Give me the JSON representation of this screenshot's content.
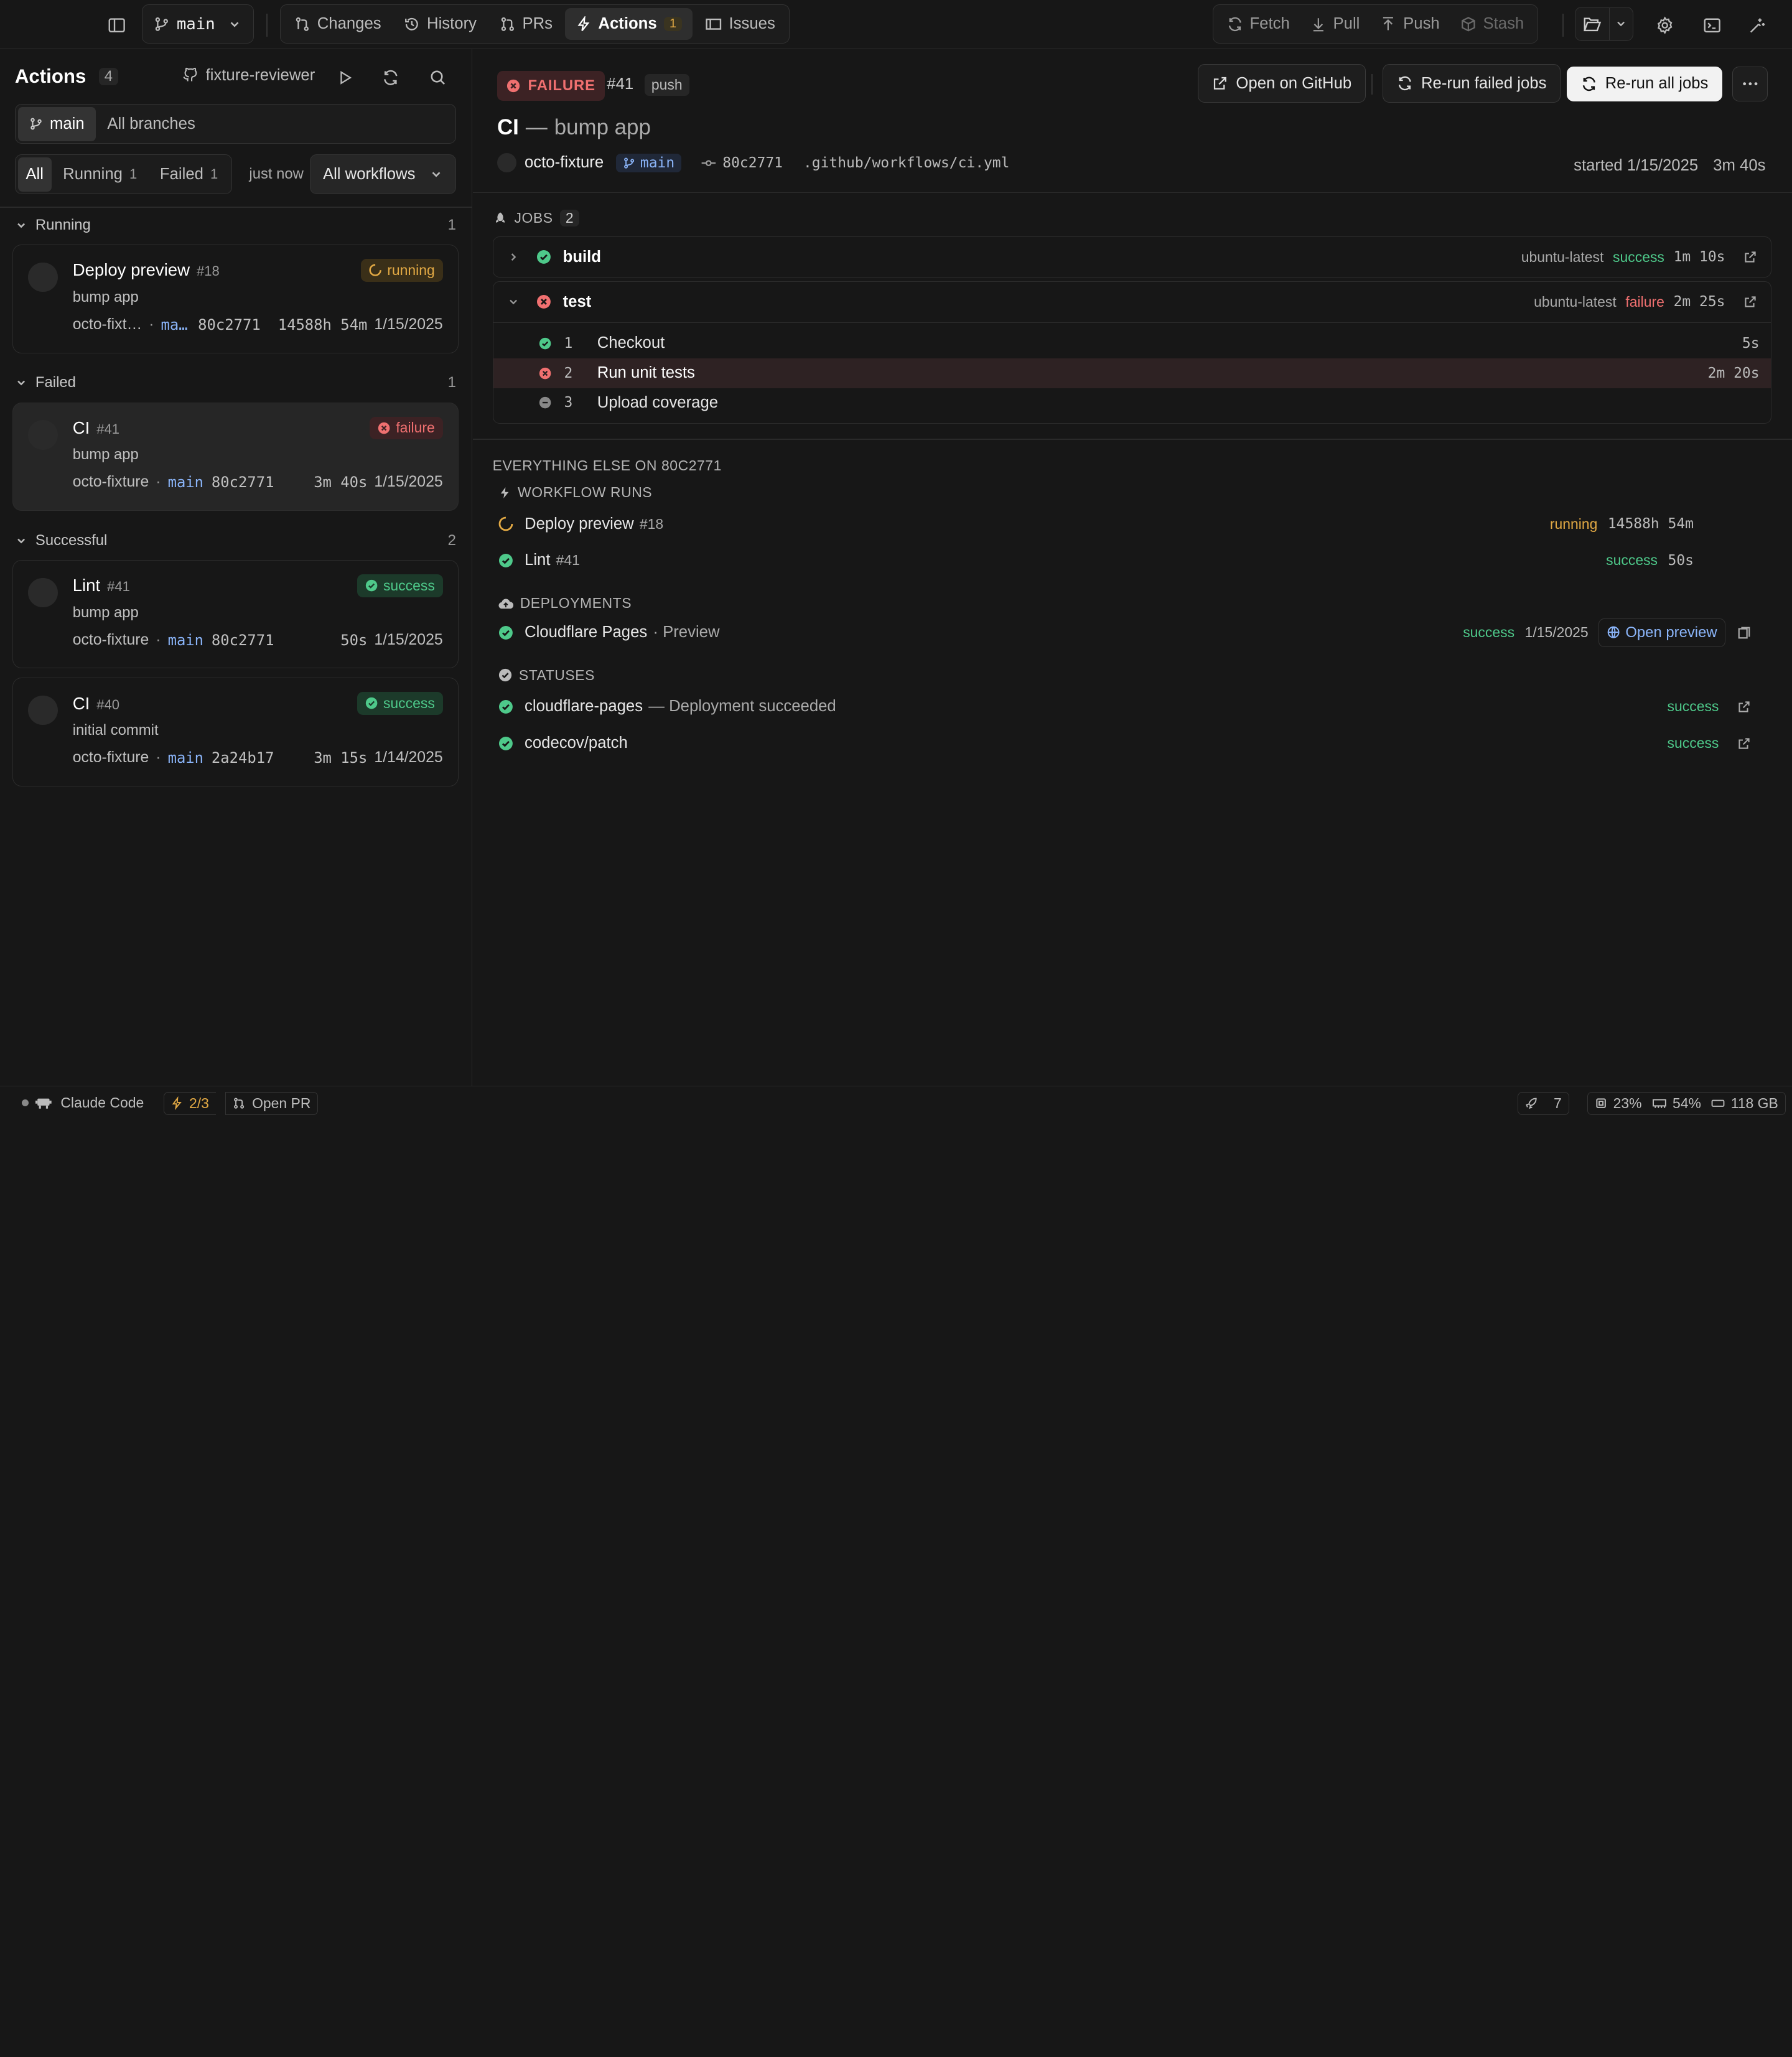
{
  "topbar": {
    "branch": "main",
    "tabs": [
      {
        "label": "Changes",
        "icon": "git-compare-icon"
      },
      {
        "label": "History",
        "icon": "history-icon"
      },
      {
        "label": "PRs",
        "icon": "pull-request-icon"
      },
      {
        "label": "Actions",
        "icon": "lightning-icon",
        "badge": "1",
        "active": true
      },
      {
        "label": "Issues",
        "icon": "issues-icon"
      }
    ],
    "fetch": "Fetch",
    "pull": "Pull",
    "push": "Push",
    "stash": "Stash"
  },
  "sidebar": {
    "title": "Actions",
    "count": "4",
    "reviewer": "fixture-reviewer",
    "branch_toggle": {
      "current": "main",
      "all": "All branches"
    },
    "filters": {
      "all": "All",
      "running": "Running",
      "running_count": "1",
      "failed": "Failed",
      "failed_count": "1",
      "updated": "just now",
      "workflow_select": "All workflows"
    },
    "sections": {
      "running": {
        "label": "Running",
        "count": "1"
      },
      "failed": {
        "label": "Failed",
        "count": "1"
      },
      "successful": {
        "label": "Successful",
        "count": "2"
      }
    },
    "runs": [
      {
        "title": "Deploy preview",
        "number": "#18",
        "status": "running",
        "message": "bump app",
        "repo": "octo-fixt…",
        "sep": "·",
        "branch": "ma…",
        "sha": "80c2771",
        "duration": "14588h 54m",
        "date": "1/15/2025"
      },
      {
        "title": "CI",
        "number": "#41",
        "status": "failure",
        "message": "bump app",
        "repo": "octo-fixture",
        "sep": "·",
        "branch": "main",
        "sha": "80c2771",
        "duration": "3m 40s",
        "date": "1/15/2025"
      },
      {
        "title": "Lint",
        "number": "#41",
        "status": "success",
        "message": "bump app",
        "repo": "octo-fixture",
        "sep": "·",
        "branch": "main",
        "sha": "80c2771",
        "duration": "50s",
        "date": "1/15/2025"
      },
      {
        "title": "CI",
        "number": "#40",
        "status": "success",
        "message": "initial commit",
        "repo": "octo-fixture",
        "sep": "·",
        "branch": "main",
        "sha": "2a24b17",
        "duration": "3m 15s",
        "date": "1/14/2025"
      }
    ]
  },
  "detail": {
    "status": "FAILURE",
    "number": "#41",
    "event": "push",
    "buttons": {
      "open_github": "Open on GitHub",
      "rerun_failed": "Re-run failed jobs",
      "rerun_all": "Re-run all jobs"
    },
    "title": "CI",
    "title_sep": "—",
    "title_msg": "bump app",
    "repo": "octo-fixture",
    "branch": "main",
    "sha": "80c2771",
    "workflow_file": ".github/workflows/ci.yml",
    "started": "started 1/15/2025",
    "duration": "3m 40s",
    "jobs_label": "JOBS",
    "jobs_count": "2",
    "jobs": [
      {
        "name": "build",
        "runner": "ubuntu-latest",
        "status": "success",
        "duration": "1m 10s"
      },
      {
        "name": "test",
        "runner": "ubuntu-latest",
        "status": "failure",
        "duration": "2m 25s",
        "steps": [
          {
            "n": "1",
            "name": "Checkout",
            "duration": "5s",
            "status": "success"
          },
          {
            "n": "2",
            "name": "Run unit tests",
            "duration": "2m 20s",
            "status": "failure"
          },
          {
            "n": "3",
            "name": "Upload coverage",
            "duration": "",
            "status": "skipped"
          }
        ]
      }
    ],
    "else_title": "EVERYTHING ELSE ON 80C2771",
    "workflow_runs_label": "WORKFLOW RUNS",
    "workflow_runs": [
      {
        "name": "Deploy preview",
        "number": "#18",
        "status": "running",
        "duration": "14588h 54m"
      },
      {
        "name": "Lint",
        "number": "#41",
        "status": "success",
        "duration": "50s"
      }
    ],
    "deployments_label": "DEPLOYMENTS",
    "deployments": [
      {
        "name": "Cloudflare Pages",
        "env": "· Preview",
        "status": "success",
        "date": "1/15/2025",
        "action": "Open preview"
      }
    ],
    "statuses_label": "STATUSES",
    "statuses": [
      {
        "name": "cloudflare-pages",
        "desc": "— Deployment succeeded",
        "status": "success"
      },
      {
        "name": "codecov/patch",
        "desc": "",
        "status": "success"
      }
    ]
  },
  "statusbar": {
    "claude": "Claude Code",
    "progress": "2/3",
    "open_pr": "Open PR",
    "agents": "7",
    "cpu": "23%",
    "mem": "54%",
    "disk": "118 GB"
  },
  "colors": {
    "success": "#4ec98a",
    "failure": "#f07070",
    "running": "#e2a944",
    "background": "#171717"
  }
}
